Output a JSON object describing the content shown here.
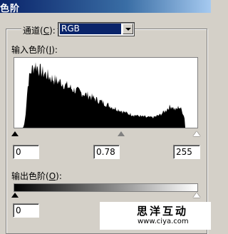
{
  "window": {
    "title": "色阶"
  },
  "channel": {
    "label_prefix": "通道(",
    "label_key": "C",
    "label_suffix": "):",
    "value": "RGB"
  },
  "input_levels": {
    "label_prefix": "输入色阶(",
    "label_key": "I",
    "label_suffix": "):",
    "black": "0",
    "gamma": "0.78",
    "white": "255"
  },
  "output_levels": {
    "label_prefix": "输出色阶(",
    "label_key": "O",
    "label_suffix": "):",
    "black": "0"
  },
  "watermark": {
    "text": "思洋互动",
    "url": "www.ciya.com"
  },
  "histogram": {
    "values": [
      0,
      2,
      8,
      20,
      38,
      55,
      66,
      72,
      78,
      82,
      84,
      86,
      88,
      90,
      90,
      88,
      87,
      85,
      83,
      82,
      81,
      80,
      79,
      78,
      78,
      77,
      76,
      75,
      74,
      73,
      72,
      71,
      71,
      70,
      69,
      69,
      68,
      67,
      67,
      66,
      66,
      66,
      65,
      64,
      63,
      62,
      61,
      61,
      60,
      59,
      58,
      58,
      57,
      56,
      55,
      55,
      54,
      54,
      53,
      53,
      52,
      52,
      51,
      50,
      50,
      49,
      49,
      48,
      48,
      47,
      47,
      46,
      46,
      45,
      44,
      44,
      43,
      42,
      42,
      41,
      40,
      40,
      39,
      38,
      38,
      37,
      37,
      36,
      35,
      35,
      34,
      33,
      33,
      32,
      31,
      31,
      30,
      29,
      29,
      28,
      28,
      27,
      27,
      26,
      26,
      25,
      25,
      24,
      23,
      23,
      22,
      22,
      21,
      21,
      20,
      20,
      20,
      19,
      19,
      19,
      18,
      18,
      18,
      18,
      17,
      17,
      17,
      17,
      16,
      16,
      16,
      16,
      16,
      15,
      15,
      15,
      15,
      15,
      15,
      15,
      15,
      15,
      15,
      16,
      16,
      17,
      17,
      18,
      18,
      19,
      20,
      21,
      22,
      23,
      24,
      25,
      27,
      28,
      29,
      30,
      30,
      31,
      30,
      28,
      27,
      26,
      26,
      27,
      29,
      30,
      29,
      27,
      25,
      22,
      18,
      14
    ],
    "noise_seed": 7
  }
}
